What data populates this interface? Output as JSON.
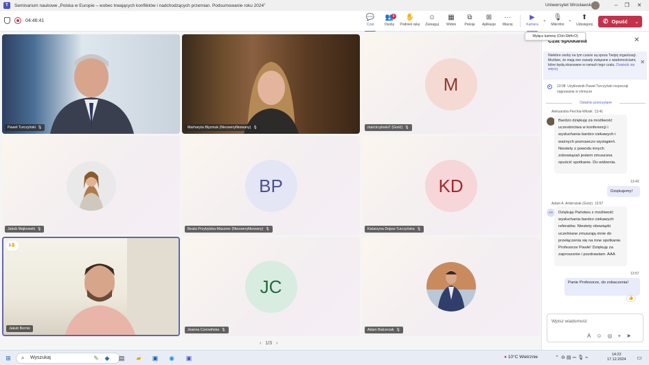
{
  "window": {
    "title": "Seminarium naukowe „Polska w Europie – wobec trwających konfliktów i nadchodzących przemian. Podsumowanie roku 2024”",
    "user": "Uniwersytet Wrocławski",
    "controls": {
      "minimize": "–",
      "restore": "❐",
      "close": "✕"
    }
  },
  "toolbar": {
    "timer": "04:46:41",
    "buttons": [
      {
        "label": "Czat",
        "icon": "chat-icon",
        "glyph": "💬"
      },
      {
        "label": "Osoby",
        "icon": "people-icon",
        "glyph": "👥",
        "badge": "9"
      },
      {
        "label": "Podnieś rękę",
        "icon": "raise-hand-icon",
        "glyph": "✋"
      },
      {
        "label": "Zareaguj",
        "icon": "react-icon",
        "glyph": "☺"
      },
      {
        "label": "Widok",
        "icon": "view-icon",
        "glyph": "▦"
      },
      {
        "label": "Pokoje",
        "icon": "rooms-icon",
        "glyph": "⧉"
      },
      {
        "label": "Aplikacje",
        "icon": "apps-icon",
        "glyph": "⊞"
      },
      {
        "label": "Więcej",
        "icon": "more-icon",
        "glyph": "···"
      },
      {
        "label": "Kamera",
        "icon": "camera-icon",
        "glyph": "▶"
      },
      {
        "label": "Mikrofon",
        "icon": "mic-off-icon",
        "glyph": "🎙"
      },
      {
        "label": "Udostępnij",
        "icon": "share-icon",
        "glyph": "⬆"
      }
    ],
    "leave_label": "Opuść",
    "camera_tooltip": "Wyłącz kamerę (Ctrl+Shift+O)"
  },
  "participants": [
    {
      "name": "Paweł Turczyński",
      "type": "video"
    },
    {
      "name": "Marharyta Blyzniuk (Niezweryfikowany)",
      "type": "video"
    },
    {
      "name": "marcin.ploski7 (Gość)",
      "type": "initials",
      "initials": "M"
    },
    {
      "name": "Jakub Majkowski",
      "type": "avatar"
    },
    {
      "name": "Beata Przybylska-Maszner (Niezweryfikowany)",
      "type": "initials",
      "initials": "BP"
    },
    {
      "name": "Katarzyna Dojwa-Turczyńska",
      "type": "initials",
      "initials": "KD"
    },
    {
      "name": "Jakub Bornio",
      "type": "video",
      "reaction": "1"
    },
    {
      "name": "Joanna Czerwińska",
      "type": "initials",
      "initials": "JC"
    },
    {
      "name": "Adam Balcerzak",
      "type": "avatar"
    }
  ],
  "pager": {
    "prev": "‹",
    "text": "1/3",
    "next": "›"
  },
  "chat": {
    "title": "Czat spotkania",
    "notice": {
      "text": "Niektóre osoby na tym czacie są spoza Twojej organizacji. Możliwe, że mają one zasady związane z wiadomościami, które będą stosowane w ramach tego czatu.",
      "link": "Dowiedz się więcej"
    },
    "system": {
      "time": "13:08",
      "text": "Użytkownik Paweł Turczyński rozpoczął nagrywanie w chmurze"
    },
    "divider": "Ostatnio przeczytane",
    "messages": [
      {
        "author": "Aleksandra Perchla-Włosik",
        "time": "13:41",
        "text": "Bardzo dziękuję za możliwość uczestnictwa w konferencji i wysłuchania bardzo ciekawych i ważnych poznawczo wystąpień. Niestety z powodu innych zobowiązań jestem zmuszona opuścić spotkanie. Do widzenia."
      },
      {
        "author": "",
        "time": "13:42",
        "text": "Dziękujemy!"
      },
      {
        "author": "Adam A. Ambroziak (Gość)",
        "time": "13:57",
        "initials": "AA",
        "text": "Dziękuję Państwu z możliwość wysłuchania bardzo ciekawych referatów. Niestety obowiązki uczelniane zmuszają mnie do przełączenia się na inne spotkanie. Profesorze Pawle! Dziękuję za zaproszenie i pozdrawiam. AAA"
      },
      {
        "author": "",
        "time": "13:57",
        "text": "Panie Profesorze, do zobaczenia!",
        "reaction": "👍"
      }
    ],
    "composer_placeholder": "Wpisz wiadomość"
  },
  "taskbar": {
    "search": "Wyszukaj",
    "weather": "10°C  Wietrznie",
    "time": "14:22",
    "date": "17.12.2024"
  }
}
